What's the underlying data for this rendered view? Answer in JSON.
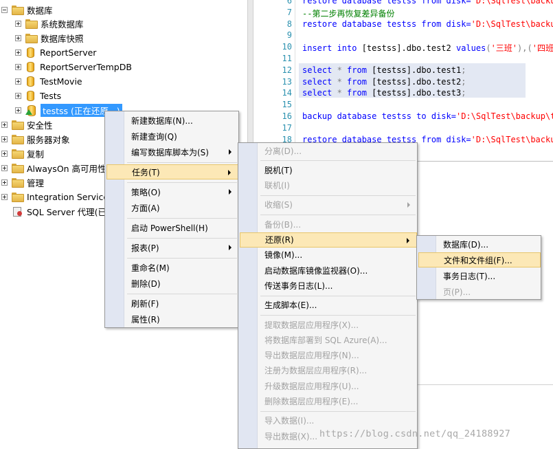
{
  "tree": {
    "items": [
      {
        "label": "数据库",
        "icon": "folder-icon",
        "expander": "minus"
      },
      {
        "label": "系统数据库",
        "icon": "folder-icon",
        "expander": "plus"
      },
      {
        "label": "数据库快照",
        "icon": "folder-icon",
        "expander": "plus"
      },
      {
        "label": "ReportServer",
        "icon": "database-icon",
        "expander": "plus"
      },
      {
        "label": "ReportServerTempDB",
        "icon": "database-icon",
        "expander": "plus"
      },
      {
        "label": "TestMovie",
        "icon": "database-icon",
        "expander": "plus"
      },
      {
        "label": "Tests",
        "icon": "database-icon",
        "expander": "plus"
      },
      {
        "label": "testss (正在还原...)",
        "icon": "restoring-database-icon",
        "expander": "plus",
        "selected": true
      },
      {
        "label": "安全性",
        "icon": "folder-icon",
        "expander": "plus"
      },
      {
        "label": "服务器对象",
        "icon": "folder-icon",
        "expander": "plus"
      },
      {
        "label": "复制",
        "icon": "folder-icon",
        "expander": "plus"
      },
      {
        "label": "AlwaysOn 高可用性",
        "icon": "folder-icon",
        "expander": "plus"
      },
      {
        "label": "管理",
        "icon": "folder-icon",
        "expander": "plus"
      },
      {
        "label": "Integration Services",
        "icon": "folder-icon",
        "expander": "plus"
      },
      {
        "label": "SQL Server 代理(已禁用代理 XP)",
        "icon": "sql-agent-icon",
        "expander": "none"
      }
    ]
  },
  "editor": {
    "lines": [
      {
        "num": "6",
        "parts": [
          {
            "t": "restore database testss from disk=",
            "c": "kw"
          },
          {
            "t": "'D:\\SqlTest\\backup\\testss.bak'",
            "c": "str"
          }
        ]
      },
      {
        "num": "7",
        "parts": [
          {
            "t": "--第二步再恢复差异备份",
            "c": "cmt"
          }
        ]
      },
      {
        "num": "8",
        "parts": [
          {
            "t": "restore database testss from disk=",
            "c": "kw"
          },
          {
            "t": "'D:\\SqlTest\\backup\\testss.bak'",
            "c": "str"
          }
        ]
      },
      {
        "num": "9",
        "parts": []
      },
      {
        "num": "10",
        "parts": [
          {
            "t": "insert into ",
            "c": "kw"
          },
          {
            "t": "[testss].dbo.test2 ",
            "c": ""
          },
          {
            "t": "values",
            "c": "kw"
          },
          {
            "t": "(",
            "c": "gry"
          },
          {
            "t": "'三班'",
            "c": "str"
          },
          {
            "t": "),(",
            "c": "gry"
          },
          {
            "t": "'四班'",
            "c": "str"
          }
        ]
      },
      {
        "num": "11",
        "parts": []
      },
      {
        "num": "12",
        "parts": [
          {
            "t": "select ",
            "c": "kw"
          },
          {
            "t": "* ",
            "c": "gry"
          },
          {
            "t": "from ",
            "c": "kw"
          },
          {
            "t": "[testss].dbo.test1",
            "c": ""
          },
          {
            "t": ";",
            "c": "gry"
          }
        ]
      },
      {
        "num": "13",
        "parts": [
          {
            "t": "select ",
            "c": "kw"
          },
          {
            "t": "* ",
            "c": "gry"
          },
          {
            "t": "from ",
            "c": "kw"
          },
          {
            "t": "[testss].dbo.test2",
            "c": ""
          },
          {
            "t": ";",
            "c": "gry"
          }
        ]
      },
      {
        "num": "14",
        "parts": [
          {
            "t": "select ",
            "c": "kw"
          },
          {
            "t": "* ",
            "c": "gry"
          },
          {
            "t": "from ",
            "c": "kw"
          },
          {
            "t": "[testss].dbo.test3",
            "c": ""
          },
          {
            "t": ";",
            "c": "gry"
          }
        ]
      },
      {
        "num": "15",
        "parts": []
      },
      {
        "num": "16",
        "parts": [
          {
            "t": "backup database testss to disk=",
            "c": "kw"
          },
          {
            "t": "'D:\\SqlTest\\backup\\testss.bak'",
            "c": "str"
          }
        ]
      },
      {
        "num": "17",
        "parts": []
      },
      {
        "num": "18",
        "parts": [
          {
            "t": "restore database testss from disk=",
            "c": "kw"
          },
          {
            "t": "'D:\\SqlTest\\backup\\testss.bak'",
            "c": "str"
          }
        ]
      }
    ]
  },
  "menu1": {
    "items": [
      {
        "label": "新建数据库(N)...",
        "name": "menu-new-database"
      },
      {
        "label": "新建查询(Q)",
        "name": "menu-new-query"
      },
      {
        "label": "编写数据库脚本为(S)",
        "name": "menu-script-database-as",
        "submenu": true
      },
      {
        "sep": true
      },
      {
        "label": "任务(T)",
        "name": "menu-tasks",
        "submenu": true,
        "hot": true
      },
      {
        "sep": true
      },
      {
        "label": "策略(O)",
        "name": "menu-policies",
        "submenu": true
      },
      {
        "label": "方面(A)",
        "name": "menu-facets"
      },
      {
        "sep": true
      },
      {
        "label": "启动 PowerShell(H)",
        "name": "menu-start-powershell"
      },
      {
        "sep": true
      },
      {
        "label": "报表(P)",
        "name": "menu-reports",
        "submenu": true
      },
      {
        "sep": true
      },
      {
        "label": "重命名(M)",
        "name": "menu-rename"
      },
      {
        "label": "删除(D)",
        "name": "menu-delete"
      },
      {
        "sep": true
      },
      {
        "label": "刷新(F)",
        "name": "menu-refresh"
      },
      {
        "label": "属性(R)",
        "name": "menu-properties"
      }
    ]
  },
  "menu2": {
    "items": [
      {
        "label": "分离(D)...",
        "name": "menu-detach",
        "disabled": true
      },
      {
        "sep": true
      },
      {
        "label": "脱机(T)",
        "name": "menu-take-offline"
      },
      {
        "label": "联机(I)",
        "name": "menu-bring-online",
        "disabled": true
      },
      {
        "sep": true
      },
      {
        "label": "收缩(S)",
        "name": "menu-shrink",
        "disabled": true,
        "submenu": true
      },
      {
        "sep": true
      },
      {
        "label": "备份(B)...",
        "name": "menu-backup",
        "disabled": true
      },
      {
        "label": "还原(R)",
        "name": "menu-restore",
        "submenu": true,
        "hot": true
      },
      {
        "label": "镜像(M)...",
        "name": "menu-mirror"
      },
      {
        "label": "启动数据库镜像监视器(O)...",
        "name": "menu-launch-mirroring-monitor"
      },
      {
        "label": "传送事务日志(L)...",
        "name": "menu-ship-transaction-logs"
      },
      {
        "sep": true
      },
      {
        "label": "生成脚本(E)...",
        "name": "menu-generate-scripts"
      },
      {
        "sep": true
      },
      {
        "label": "提取数据层应用程序(X)...",
        "name": "menu-extract-data-tier",
        "disabled": true
      },
      {
        "label": "将数据库部署到 SQL Azure(A)...",
        "name": "menu-deploy-to-azure",
        "disabled": true
      },
      {
        "label": "导出数据层应用程序(N)...",
        "name": "menu-export-data-tier",
        "disabled": true
      },
      {
        "label": "注册为数据层应用程序(R)...",
        "name": "menu-register-data-tier",
        "disabled": true
      },
      {
        "label": "升级数据层应用程序(U)...",
        "name": "menu-upgrade-data-tier",
        "disabled": true
      },
      {
        "label": "删除数据层应用程序(E)...",
        "name": "menu-delete-data-tier",
        "disabled": true
      },
      {
        "sep": true
      },
      {
        "label": "导入数据(I)...",
        "name": "menu-import-data",
        "disabled": true
      },
      {
        "label": "导出数据(X)...",
        "name": "menu-export-data",
        "disabled": true
      }
    ]
  },
  "menu3": {
    "items": [
      {
        "label": "数据库(D)...",
        "name": "menu-restore-database"
      },
      {
        "label": "文件和文件组(F)...",
        "name": "menu-restore-files-filegroups",
        "hot": true
      },
      {
        "label": "事务日志(T)...",
        "name": "menu-restore-transaction-log"
      },
      {
        "label": "页(P)...",
        "name": "menu-restore-page",
        "disabled": true
      }
    ]
  },
  "watermark": "https://blog.csdn.net/qq_24188927"
}
